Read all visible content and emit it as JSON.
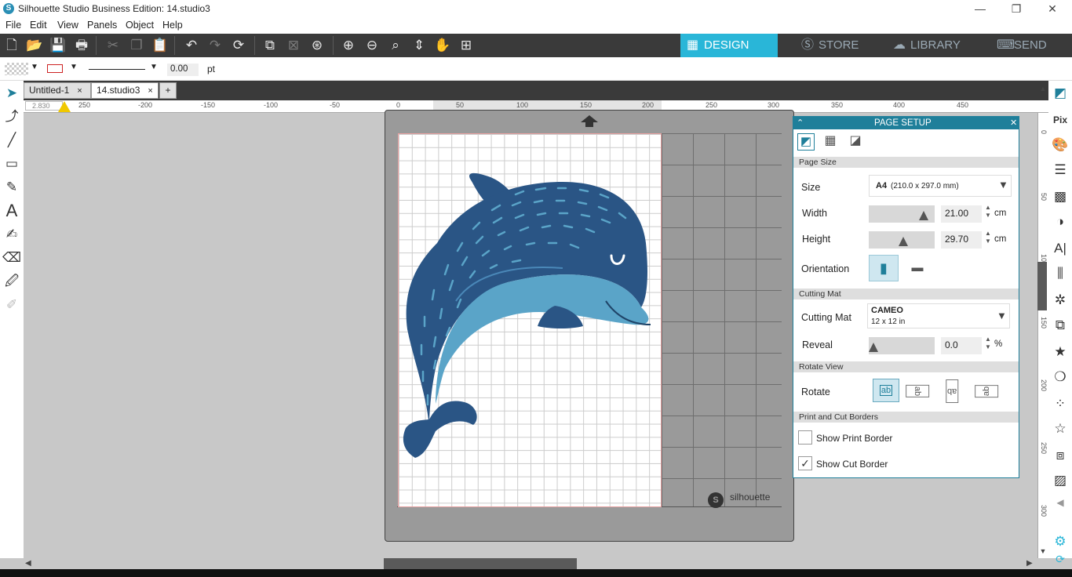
{
  "window": {
    "title": "Silhouette Studio Business Edition: 14.studio3",
    "minimize": "—",
    "restore": "❐",
    "close": "✕"
  },
  "menu": [
    "File",
    "Edit",
    "View",
    "Panels",
    "Object",
    "Help"
  ],
  "toolbar": {
    "modes": [
      {
        "label": "DESIGN",
        "icon": "grid-icon",
        "active": true
      },
      {
        "label": "STORE",
        "icon": "s-icon",
        "active": false
      },
      {
        "label": "LIBRARY",
        "icon": "cloud-icon",
        "active": false
      },
      {
        "label": "SEND",
        "icon": "cutter-icon",
        "active": false
      }
    ]
  },
  "properties": {
    "line_width": "0.00",
    "unit": "pt"
  },
  "tabs": [
    {
      "label": "Untitled-1",
      "active": false
    },
    {
      "label": "14.studio3",
      "active": true
    }
  ],
  "tab_close": "×",
  "tab_add": "+",
  "ruler": {
    "top_labels": [
      "250",
      "-200",
      "-150",
      "-100",
      "-50",
      "0",
      "50",
      "100",
      "150",
      "200",
      "250",
      "300",
      "350",
      "400",
      "450"
    ],
    "coord_readout": "2.830",
    "right_labels": [
      "0",
      "50",
      "100",
      "150",
      "200",
      "250",
      "300"
    ]
  },
  "mat": {
    "brand": "silhouette"
  },
  "page_setup": {
    "title": "PAGE SETUP",
    "close": "✕",
    "sections": {
      "page_size": "Page Size",
      "cutting_mat": "Cutting Mat",
      "rotate_view": "Rotate View",
      "print_cut": "Print and Cut Borders"
    },
    "size_label": "Size",
    "size_value_bold": "A4",
    "size_value_rest": "(210.0 x 297.0 mm)",
    "width_label": "Width",
    "width_value": "21.00",
    "width_unit": "cm",
    "height_label": "Height",
    "height_value": "29.70",
    "height_unit": "cm",
    "orientation_label": "Orientation",
    "mat_label": "Cutting Mat",
    "mat_value": "CAMEO",
    "mat_sub": "12 x 12 in",
    "reveal_label": "Reveal",
    "reveal_value": "0.0",
    "reveal_unit": "%",
    "rotate_label": "Rotate",
    "rotate_glyph": "ab",
    "show_print_border": "Show Print Border",
    "show_print_border_checked": false,
    "show_cut_border": "Show Cut Border",
    "show_cut_border_checked": true
  },
  "colors": {
    "accent": "#29b6d8",
    "panel_header": "#1f7f9a",
    "dolphin_dark": "#2a5585",
    "dolphin_light": "#5aa4c8"
  }
}
